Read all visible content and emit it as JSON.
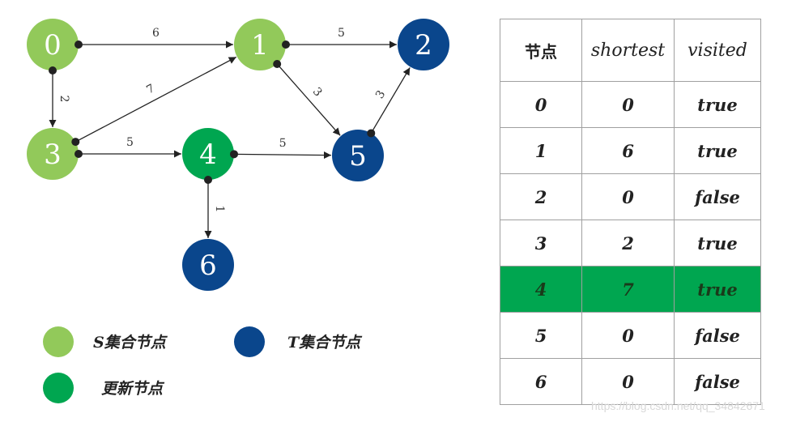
{
  "colors": {
    "s_set": "#92c95a",
    "t_set": "#0a468c",
    "updated": "#00a650",
    "edge": "#222222"
  },
  "graph": {
    "nodes": [
      {
        "id": "0",
        "label": "0",
        "group": "s_set"
      },
      {
        "id": "1",
        "label": "1",
        "group": "s_set"
      },
      {
        "id": "2",
        "label": "2",
        "group": "t_set"
      },
      {
        "id": "3",
        "label": "3",
        "group": "s_set"
      },
      {
        "id": "4",
        "label": "4",
        "group": "updated"
      },
      {
        "id": "5",
        "label": "5",
        "group": "t_set"
      },
      {
        "id": "6",
        "label": "6",
        "group": "t_set"
      }
    ],
    "edges": [
      {
        "from": "0",
        "to": "1",
        "weight": "6"
      },
      {
        "from": "1",
        "to": "2",
        "weight": "5"
      },
      {
        "from": "0",
        "to": "3",
        "weight": "2"
      },
      {
        "from": "3",
        "to": "1",
        "weight": "7"
      },
      {
        "from": "1",
        "to": "5",
        "weight": "3"
      },
      {
        "from": "5",
        "to": "2",
        "weight": "3"
      },
      {
        "from": "3",
        "to": "4",
        "weight": "5"
      },
      {
        "from": "4",
        "to": "5",
        "weight": "5"
      },
      {
        "from": "4",
        "to": "6",
        "weight": "1"
      }
    ]
  },
  "legend": {
    "s_set": "S集合节点",
    "t_set": "T集合节点",
    "updated": "更新节点"
  },
  "table": {
    "headers": [
      "节点",
      "shortest",
      "visited"
    ],
    "rows": [
      {
        "node": "0",
        "shortest": "0",
        "visited": "true",
        "highlight": false
      },
      {
        "node": "1",
        "shortest": "6",
        "visited": "true",
        "highlight": false
      },
      {
        "node": "2",
        "shortest": "0",
        "visited": "false",
        "highlight": false
      },
      {
        "node": "3",
        "shortest": "2",
        "visited": "true",
        "highlight": false
      },
      {
        "node": "4",
        "shortest": "7",
        "visited": "true",
        "highlight": true
      },
      {
        "node": "5",
        "shortest": "0",
        "visited": "false",
        "highlight": false
      },
      {
        "node": "6",
        "shortest": "0",
        "visited": "false",
        "highlight": false
      }
    ]
  },
  "watermark": "https://blog.csdn.net/qq_34842671"
}
